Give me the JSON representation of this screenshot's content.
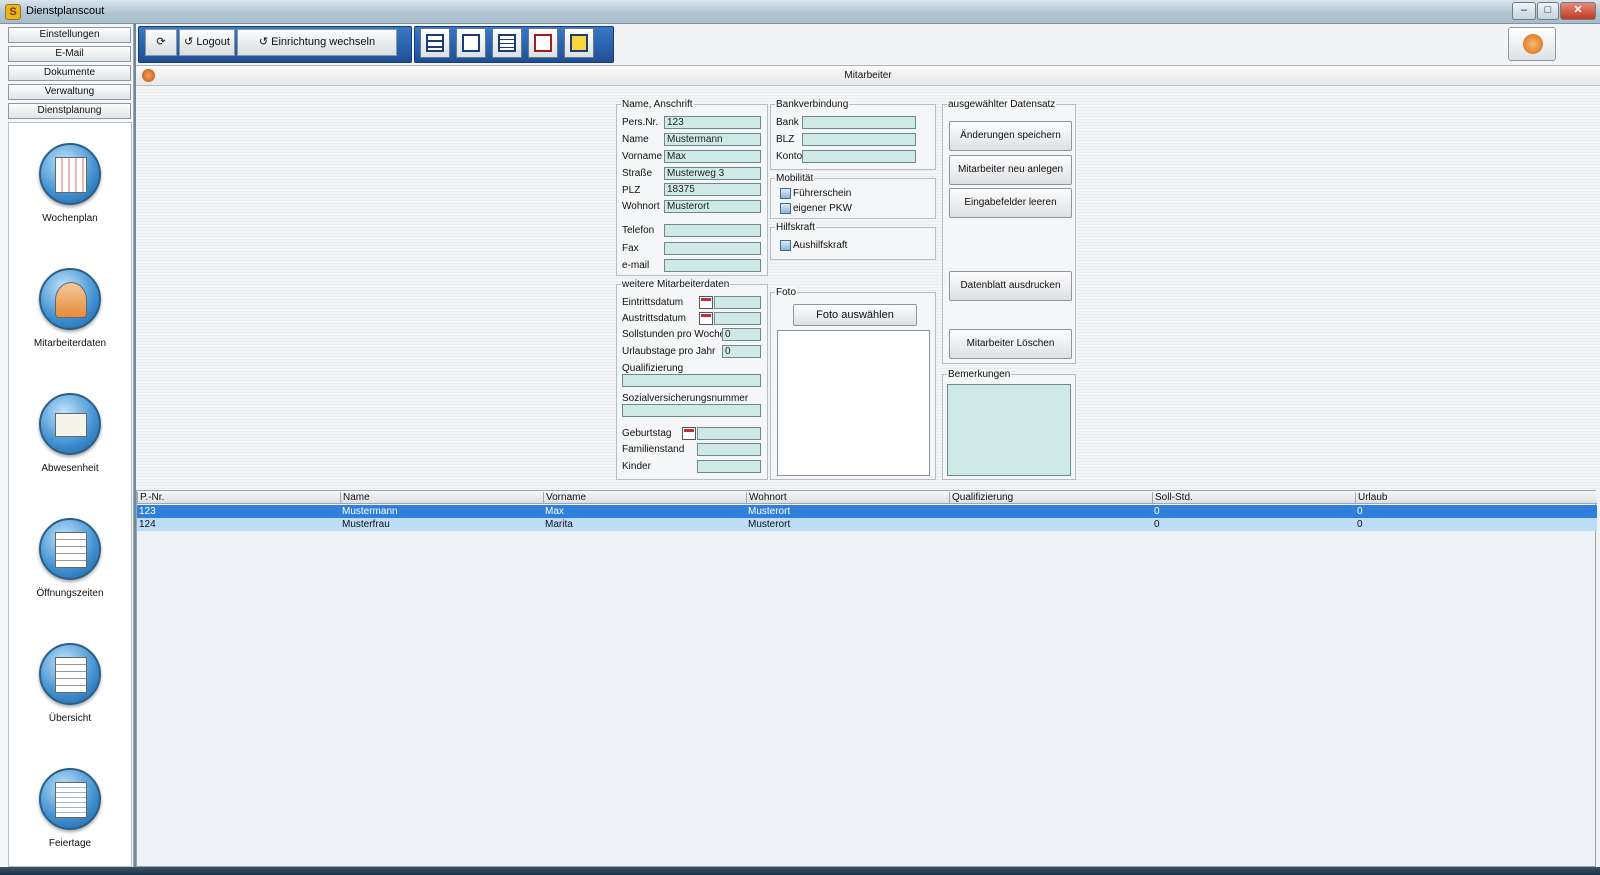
{
  "window": {
    "title": "Dienstplanscout",
    "controls": [
      "–",
      "□",
      "✕"
    ]
  },
  "sidebar": {
    "menu": [
      "Einstellungen",
      "E-Mail",
      "Dokumente",
      "Verwaltung",
      "Dienstplanung"
    ],
    "items": [
      {
        "label": "Wochenplan",
        "icon": "calendar-icon"
      },
      {
        "label": "Mitarbeiterdaten",
        "icon": "people-icon"
      },
      {
        "label": "Abwesenheit",
        "icon": "book-icon"
      },
      {
        "label": "Öffnungszeiten",
        "icon": "clipboard-icon"
      },
      {
        "label": "Übersicht",
        "icon": "checklist-icon"
      },
      {
        "label": "Feiertage",
        "icon": "spreadsheet-icon"
      }
    ]
  },
  "toolbar": {
    "logout": "Logout",
    "switch": "Einrichtung wechseln"
  },
  "page": {
    "title": "Mitarbeiter"
  },
  "address": {
    "legend": "Name, Anschrift",
    "labels": {
      "persnr": "Pers.Nr.",
      "name": "Name",
      "vorname": "Vorname",
      "strasse": "Straße",
      "plz": "PLZ",
      "wohnort": "Wohnort",
      "telefon": "Telefon",
      "fax": "Fax",
      "email": "e-mail"
    },
    "values": {
      "persnr": "123",
      "name": "Mustermann",
      "vorname": "Max",
      "strasse": "Musterweg 3",
      "plz": "18375",
      "wohnort": "Musterort",
      "telefon": "",
      "fax": "",
      "email": ""
    }
  },
  "bank": {
    "legend": "Bankverbindung",
    "labels": {
      "bank": "Bank",
      "blz": "BLZ",
      "konto": "Konto"
    }
  },
  "mobility": {
    "legend": "Mobilität",
    "fuehrerschein": "Führerschein",
    "pkw": "eigener PKW"
  },
  "helper": {
    "legend": "Hilfskraft",
    "aushilfskraft": "Aushilfskraft"
  },
  "foto": {
    "legend": "Foto",
    "button": "Foto auswählen"
  },
  "more": {
    "legend": "weitere Mitarbeiterdaten",
    "labels": {
      "eintritt": "Eintrittsdatum",
      "austritt": "Austrittsdatum",
      "soll": "Sollstunden pro Woche",
      "urlaub": "Urlaubstage pro Jahr",
      "quali": "Qualifizierung",
      "sv": "Sozialversicherungsnummer",
      "geburtstag": "Geburtstag",
      "familienstand": "Familienstand",
      "kinder": "Kinder"
    },
    "values": {
      "soll": "0",
      "urlaub": "0"
    }
  },
  "record": {
    "legend": "ausgewählter Datensatz",
    "buttons": {
      "save": "Änderungen speichern",
      "new": "Mitarbeiter neu anlegen",
      "clear": "Eingabefelder leeren",
      "print": "Datenblatt ausdrucken",
      "delete": "Mitarbeiter Löschen"
    }
  },
  "remarks": {
    "legend": "Bemerkungen"
  },
  "grid": {
    "columns": [
      "P.-Nr.",
      "Name",
      "Vorname",
      "Wohnort",
      "Qualifizierung",
      "Soll-Std.",
      "Urlaub"
    ],
    "rows": [
      [
        "123",
        "Mustermann",
        "Max",
        "Musterort",
        "",
        "0",
        "0"
      ],
      [
        "124",
        "Musterfrau",
        "Marita",
        "Musterort",
        "",
        "0",
        "0"
      ]
    ],
    "selected_color": "#2f7fdb",
    "alt_color": "#bcdcf7"
  }
}
